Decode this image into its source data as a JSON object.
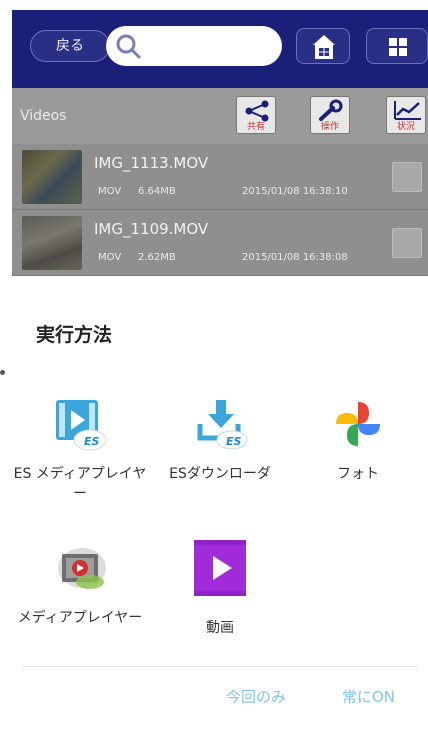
{
  "toolbar": {
    "back_label": "戻る",
    "search_placeholder": ""
  },
  "pathbar": {
    "label": "Videos",
    "tools": [
      {
        "label": "共有",
        "icon": "share-icon"
      },
      {
        "label": "操作",
        "icon": "wrench-icon"
      },
      {
        "label": "状況",
        "icon": "chart-icon"
      }
    ]
  },
  "files": [
    {
      "name": "IMG_1113.MOV",
      "type": "MOV",
      "size": "6.64MB",
      "date": "2015/01/08 16:38:10"
    },
    {
      "name": "IMG_1109.MOV",
      "type": "MOV",
      "size": "2.62MB",
      "date": "2015/01/08 16:38:08"
    }
  ],
  "sheet": {
    "title": "実行方法",
    "apps": [
      {
        "label": "ES メディアプレイヤー",
        "icon": "es-media-player-icon"
      },
      {
        "label": "ESダウンローダ",
        "icon": "es-downloader-icon"
      },
      {
        "label": "フォト",
        "icon": "photos-pinwheel-icon"
      },
      {
        "label": "メディアプレイヤー",
        "icon": "media-player-icon"
      },
      {
        "label": "動画",
        "icon": "video-play-icon"
      }
    ],
    "actions": {
      "once": "今回のみ",
      "always": "常にON"
    }
  },
  "colors": {
    "toolbar_bg": "#1a1f7a",
    "accent": "#85c5e8",
    "video_purple": "#a12bd9"
  }
}
